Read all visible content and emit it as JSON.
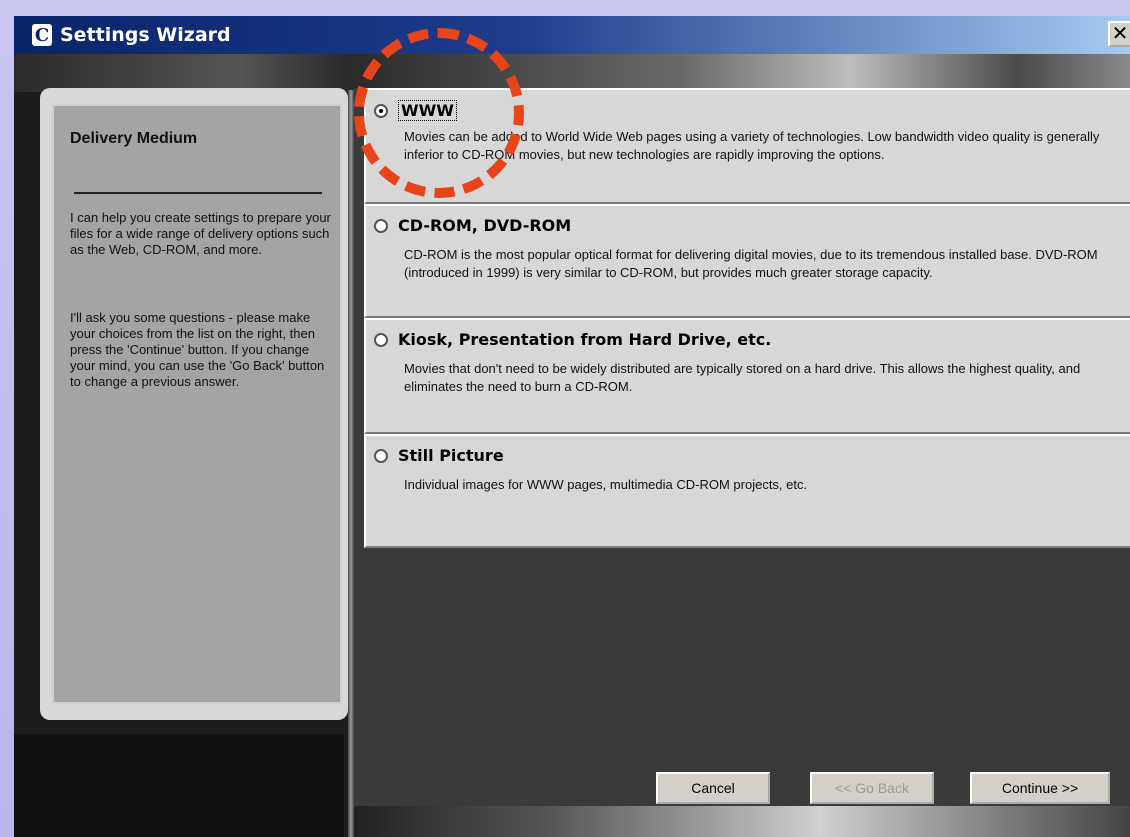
{
  "window": {
    "title": "Settings Wizard",
    "icon": "C",
    "close_label": "✕"
  },
  "sidebar": {
    "title": "Delivery Medium",
    "para1": "I can help you create settings to prepare your files for a wide range of delivery options such as the Web, CD-ROM, and more.",
    "para2": "I'll ask you some questions - please make your choices from the list on the right, then press the 'Continue' button.  If you change your mind, you can use the 'Go Back' button to change a previous answer."
  },
  "options": [
    {
      "label": "WWW",
      "selected": true,
      "description": "Movies can be added to World Wide Web pages using a variety of technologies.  Low bandwidth video quality is generally inferior to CD-ROM movies, but new technologies are rapidly improving the options."
    },
    {
      "label": "CD-ROM, DVD-ROM",
      "selected": false,
      "description": "CD-ROM is the most popular optical format for delivering digital movies, due to its tremendous installed base.  DVD-ROM (introduced in 1999) is very similar to CD-ROM, but provides much greater storage capacity."
    },
    {
      "label": "Kiosk, Presentation from Hard Drive, etc.",
      "selected": false,
      "description": "Movies that don't need to be widely distributed are typically stored on a hard drive. This allows the highest quality, and eliminates the need to burn a CD-ROM."
    },
    {
      "label": "Still Picture",
      "selected": false,
      "description": "Individual images for WWW pages, multimedia CD-ROM projects, etc."
    }
  ],
  "buttons": {
    "cancel": "Cancel",
    "go_back": "<< Go Back",
    "continue": "Continue >>"
  },
  "colors": {
    "highlight_ring": "#e8441a",
    "titlebar": "#0a246a"
  }
}
